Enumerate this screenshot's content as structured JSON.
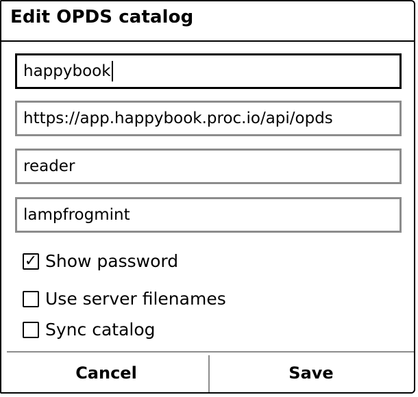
{
  "dialog": {
    "title": "Edit OPDS catalog"
  },
  "fields": {
    "name": {
      "value": "happybook"
    },
    "url": {
      "value": "https://app.happybook.proc.io/api/opds"
    },
    "username": {
      "value": "reader"
    },
    "password": {
      "value": "lampfrogmint"
    }
  },
  "options": {
    "show_password": {
      "label": "Show password",
      "checked": true,
      "mark": "✓"
    },
    "use_server_filenames": {
      "label": "Use server filenames",
      "checked": false
    },
    "sync_catalog": {
      "label": "Sync catalog",
      "checked": false
    }
  },
  "buttons": {
    "cancel_label": "Cancel",
    "save_label": "Save"
  },
  "colors": {
    "border": "#000000",
    "field_border": "#8c8c8c",
    "background": "#ffffff"
  }
}
